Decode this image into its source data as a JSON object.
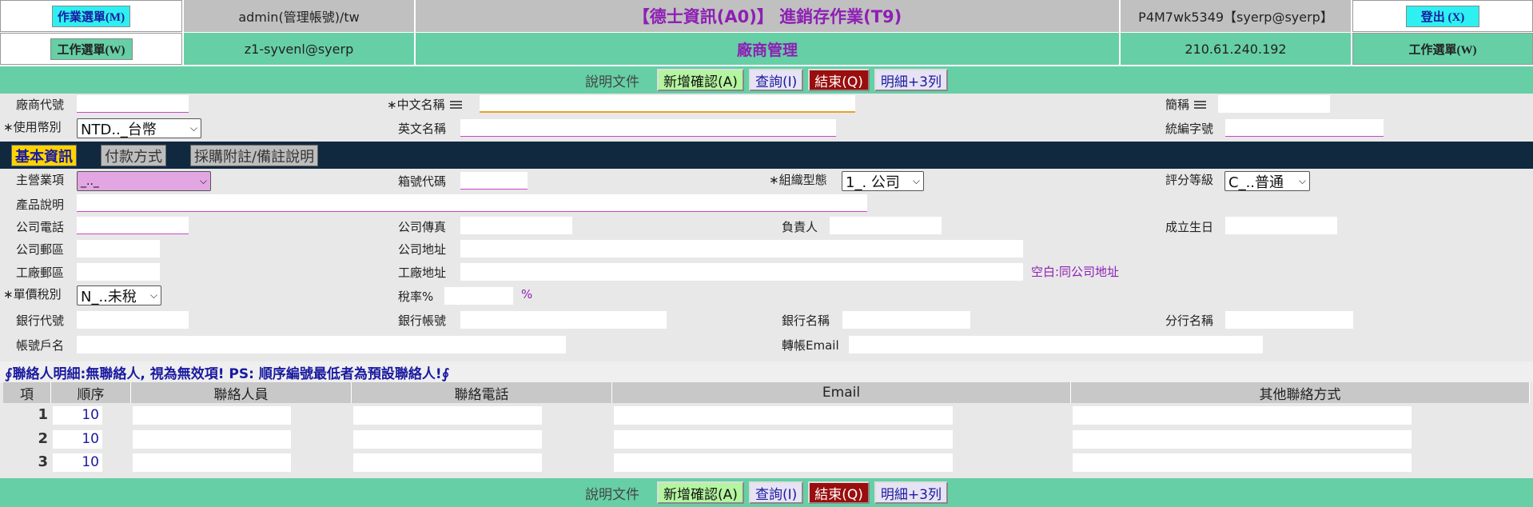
{
  "header": {
    "work_menu_btn": "作業選單(M)",
    "user": "admin(管理帳號)/tw",
    "title": "【德士資訊(A0)】 進銷存作業(T9)",
    "session": "P4M7wk5349【syerp@syerp】",
    "logout_btn": "登出  (X)",
    "job_menu_btn_left": "工作選單(W)",
    "email": "z1-syvenl@syerp",
    "module": "廠商管理",
    "ip": "210.61.240.192",
    "job_menu_btn_right": "工作選單(W)"
  },
  "toolbar": {
    "doc": "說明文件",
    "add": "新增確認(A)",
    "query": "查詢(I)",
    "end": "結束(Q)",
    "detail": "明細+3列"
  },
  "form": {
    "vendor_code": "廠商代號",
    "cn_name": "∗中文名稱",
    "short_name": "簡稱",
    "currency": "∗使用幣別",
    "currency_value": "NTD.._台幣",
    "en_name": "英文名稱",
    "tax_id": "統編字號"
  },
  "tabs": {
    "basic": "基本資訊",
    "payment": "付款方式",
    "purchase": "採購附註/備註說明"
  },
  "basic": {
    "main_business": "主營業項",
    "main_business_value": "_.._",
    "box_code": "箱號代碼",
    "org_type": "∗組織型態",
    "org_type_value": "1_. 公司",
    "rating": "評分等級",
    "rating_value": "C_..普通",
    "product_desc": "產品說明",
    "company_phone": "公司電話",
    "company_fax": "公司傳真",
    "owner": "負責人",
    "founded": "成立生日",
    "company_zip": "公司郵區",
    "company_address": "公司地址",
    "factory_zip": "工廠郵區",
    "factory_address": "工廠地址",
    "factory_hint": "空白:同公司地址",
    "price_tax": "∗單價稅別",
    "price_tax_value": "N_..未稅",
    "tax_rate": "稅率%",
    "percent": "%",
    "bank_code": "銀行代號",
    "bank_account": "銀行帳號",
    "bank_name": "銀行名稱",
    "branch_name": "分行名稱",
    "account_holder": "帳號戶名",
    "transfer_email": "轉帳Email"
  },
  "contacts": {
    "title": "∮聯絡人明細:無聯絡人, 視為無效項! PS: 順序編號最低者為預設聯絡人!∮",
    "columns": [
      "項",
      "順序",
      "聯絡人員",
      "聯絡電話",
      "Email",
      "其他聯絡方式"
    ],
    "rows": [
      {
        "no": "1",
        "order": "10"
      },
      {
        "no": "2",
        "order": "10"
      },
      {
        "no": "3",
        "order": "10"
      }
    ]
  },
  "colors": {
    "header_green": "#66cfa6",
    "title_purple": "#8e1fb4",
    "cyan_button": "#2ef0f0",
    "tab_bar": "#11293f",
    "active_tab": "#ffd400"
  }
}
